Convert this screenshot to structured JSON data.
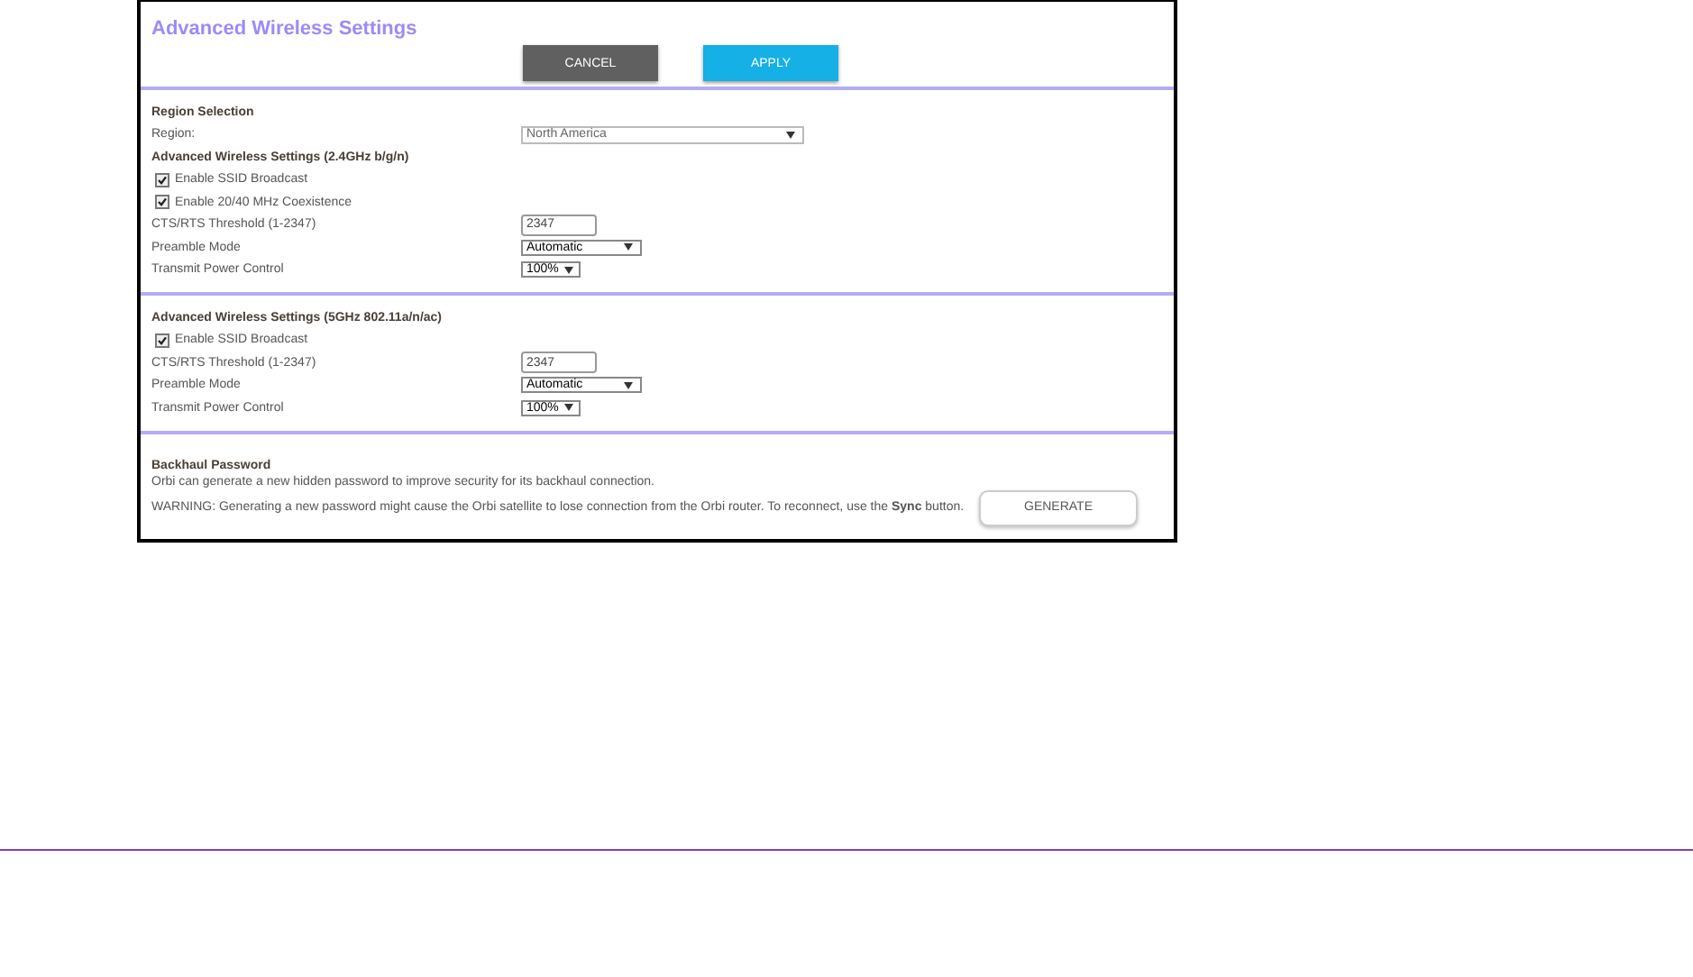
{
  "title": "Advanced Wireless Settings",
  "buttons": [
    {
      "label": "CANCEL",
      "kind": "cancel"
    },
    {
      "label": "APPLY",
      "kind": "apply"
    }
  ],
  "sections": [
    {
      "rows": [
        {
          "kind": "heading",
          "text": "Region Selection"
        },
        {
          "kind": "field",
          "label": "Region:",
          "control": {
            "kind": "dropdown",
            "value": "North America"
          }
        },
        {
          "kind": "heading",
          "text": "Advanced Wireless Settings (2.4GHz b/g/n)"
        },
        {
          "kind": "checkbox",
          "label": "Enable SSID Broadcast",
          "checked": true
        },
        {
          "kind": "checkbox",
          "label": "Enable 20/40 MHz Coexistence",
          "checked": true
        },
        {
          "kind": "field",
          "label": "CTS/RTS Threshold (1-2347)",
          "control": {
            "kind": "text",
            "value": "2347"
          }
        },
        {
          "kind": "field",
          "label": "Preamble Mode",
          "control": {
            "kind": "select",
            "value": "Automatic"
          }
        },
        {
          "kind": "field",
          "label": "Transmit Power Control",
          "control": {
            "kind": "menu",
            "value": "100%"
          }
        }
      ]
    },
    {
      "rows": [
        {
          "kind": "heading",
          "text": "Advanced Wireless Settings (5GHz 802.11a/n/ac)"
        },
        {
          "kind": "checkbox",
          "label": "Enable SSID Broadcast",
          "checked": true
        },
        {
          "kind": "field",
          "label": "CTS/RTS Threshold (1-2347)",
          "control": {
            "kind": "text",
            "value": "2347"
          }
        },
        {
          "kind": "field",
          "label": "Preamble Mode",
          "control": {
            "kind": "select",
            "value": "Automatic"
          }
        },
        {
          "kind": "field",
          "label": "Transmit Power Control",
          "control": {
            "kind": "menu",
            "value": "100%"
          }
        }
      ]
    }
  ],
  "backhaul": {
    "heading": "Backhaul Password",
    "text": "Orbi can generate a new hidden password to improve security for its backhaul connection.",
    "warning": "WARNING: Generating a new password might cause the Orbi satellite to lose connection from the Orbi router. To reconnect, use the **Sync** button.",
    "button": "GENERATE"
  }
}
